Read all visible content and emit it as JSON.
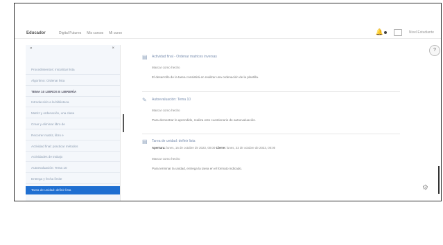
{
  "topbar": {
    "brand": "Educador",
    "links": [
      "Digital Futures",
      "Mis cursos",
      "Mi curso"
    ],
    "notif_icon": "bell-icon",
    "msg_icon": "message-icon",
    "user_label": "Nivel Estudiante"
  },
  "sidebar": {
    "collapse_label": "«",
    "close_label": "×",
    "items": [
      {
        "label": "Procedimientos: inicializar lista",
        "style": "normal"
      },
      {
        "label": "Algoritmo: Ordenar lista",
        "style": "normal"
      },
      {
        "label": "TEMA 10 LIBROS E LIBRERÍA",
        "style": "bold"
      },
      {
        "label": "Introducción a la biblioteca",
        "style": "normal"
      },
      {
        "label": "Matriz y ordenación, una clase",
        "style": "normal"
      },
      {
        "label": "Crear y eliminar libro de",
        "style": "normal"
      },
      {
        "label": "Recorrer matriz, libro e",
        "style": "normal"
      },
      {
        "label": "Actividad final: practicar métodos",
        "style": "normal"
      },
      {
        "label": "Actividades de trabajo",
        "style": "normal"
      },
      {
        "label": "Autoevaluación: Tema 10",
        "style": "normal"
      },
      {
        "label": "Entrega y fecha límite",
        "style": "normal"
      },
      {
        "label": "Tarea de unidad: definir lista",
        "style": "active"
      }
    ]
  },
  "cards": [
    {
      "icon": "document-icon",
      "title": "Actividad final - Ordenar matrices inversas",
      "sub": "Marcar como hecho",
      "desc": "El desarrollo de la tarea consistirá en realizar una ordenación de la plantilla."
    },
    {
      "icon": "pencil-icon",
      "title": "Autoevaluación: Tema 10",
      "sub": "Marcar como hecho",
      "desc": "Para demostrar lo aprendido, realiza este cuestionario de autoevaluación."
    },
    {
      "icon": "assignment-icon",
      "title": "Tarea de unidad: definir lista",
      "meta_open_label": "Apertura:",
      "meta_open_value": "lunes, 16 de octubre de 2023, 00:00",
      "meta_due_label": "Cierre:",
      "meta_due_value": "lunes, 23 de octubre de 2023, 00:00",
      "sub": "Marcar como hecho",
      "desc": "Para terminar la unidad, entrega la tarea en el formato indicado."
    }
  ],
  "help_label": "?",
  "settings_icon": "gear-icon"
}
